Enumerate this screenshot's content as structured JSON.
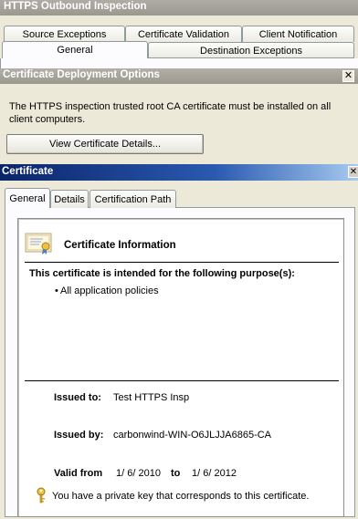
{
  "outer_window": {
    "title": "HTTPS Outbound Inspection",
    "tabs_row1": [
      "Source Exceptions",
      "Certificate Validation",
      "Client Notification"
    ],
    "tabs_row2": [
      "General",
      "Destination Exceptions"
    ]
  },
  "deployment_dialog": {
    "title": "Certificate Deployment Options",
    "close_glyph": "✕",
    "message": "The HTTPS inspection trusted root CA certificate must be installed on all client computers.",
    "view_button": "View Certificate Details..."
  },
  "certificate_dialog": {
    "title": "Certificate",
    "close_glyph": "✕",
    "tabs": [
      "General",
      "Details",
      "Certification Path"
    ],
    "info_heading": "Certificate Information",
    "purpose_heading": "This certificate is intended for the following purpose(s):",
    "purposes": [
      "All application policies"
    ],
    "issued_to_label": "Issued to:",
    "issued_to_value": "Test HTTPS Insp",
    "issued_by_label": "Issued by:",
    "issued_by_value": "carbonwind-WIN-O6JLJJA6865-CA",
    "valid_from_label": "Valid from",
    "valid_from_value": "1/ 6/ 2010",
    "valid_to_label": "to",
    "valid_to_value": "1/ 6/ 2012",
    "private_key_note": "You have a private key that corresponds to this certificate.",
    "bullet": "•"
  }
}
